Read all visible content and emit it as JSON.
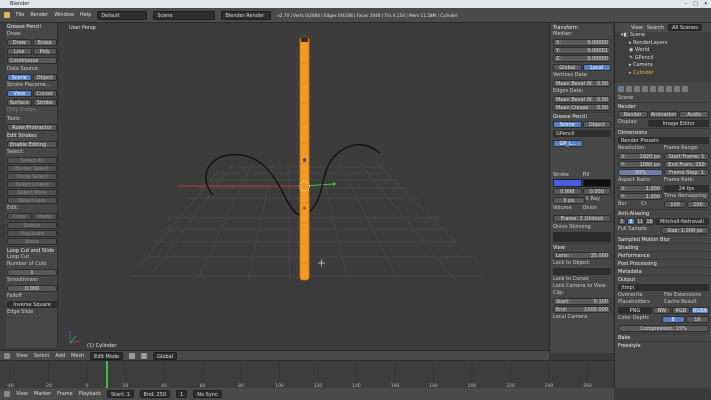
{
  "window": {
    "title": "Blender"
  },
  "info": {
    "menus": [
      "File",
      "Render",
      "Window",
      "Help"
    ],
    "layout": "Default",
    "scene": "Scene",
    "engine": "Blender Render",
    "stats": "v2.70 | Verts 0/2084 | Edges 0/4108 | Faces 2048 | Tris 4,154 | Mem 11.58M | Cylinder"
  },
  "toolshelf": {
    "header": "Grease Pencil",
    "draw_label": "Draw:",
    "draw_btns": [
      "Draw",
      "Erase"
    ],
    "line_btns": [
      "Line",
      "Poly"
    ],
    "continuous": "Continuous",
    "data_source": "Data Source:",
    "source_btns": [
      "Scene",
      "Object"
    ],
    "stroke_placement": "Stroke Placeme...",
    "placement_btns": [
      "View",
      "Cursor",
      "Surface",
      "Stroke"
    ],
    "only_endpoints": "Only Endpo...",
    "tools": "Tools:",
    "ruler": "Ruler/Protractor",
    "edit_strokes": "Edit Strokes",
    "enable_editing": "Enable Editing",
    "select": "Select:",
    "select_btns": [
      "Select All",
      "Border Select",
      "Circle Select",
      "Select Linked",
      "Select More",
      "Select Less"
    ],
    "edit": "Edit:",
    "edit_btns": [
      "Copy",
      "Paste",
      "Delete",
      "Duplicate",
      "Move"
    ],
    "operator_header": "Loop Cut and Slide",
    "loopcut": "Loop Cut",
    "num_cuts_label": "Number of Cuts",
    "num_cuts": "1",
    "smoothness_label": "Smoothness",
    "smoothness": "0.000",
    "falloff_label": "Falloff",
    "falloff": "Inverse Square",
    "edge_slide": "Edge Slide"
  },
  "viewport": {
    "label": "User Persp",
    "object": "(1) Cylinder"
  },
  "npanel": {
    "transform": "Transform",
    "median": "Median:",
    "x": "0.00000",
    "y": "0.00001",
    "z": "0.00000",
    "global": "Global",
    "local": "Local",
    "vertices_data": "Vertices Data:",
    "mean_bevel": "Mean Bevel W.",
    "mean_bevel_val": "0.00",
    "edges_data": "Edges Data:",
    "mean_bevel_e": "0.00",
    "mean_crease": "Mean Crease",
    "mean_crease_val": "0.00",
    "grease_pencil": "Grease Pencil",
    "gp_src": [
      "Scene",
      "Object"
    ],
    "gp_name": "GPencil",
    "layer": "GP_L...",
    "stroke": "Stroke",
    "fill": "Fill",
    "stroke_val": "0.998",
    "fill_val": "0.000",
    "thickness": "3 px",
    "xray": "X Ray",
    "volume": "Volume",
    "onion": "Onion",
    "frame": "Frame: 1 (Unlock",
    "onion_skin": "Onion Skinning",
    "view": "View",
    "lens_label": "Lens:",
    "lens": "35.000",
    "lock_to_object": "Lock to Object:",
    "lock_to_cursor": "Lock to Cursor",
    "lock_camera": "Lock Camera to View",
    "clip": "Clip:",
    "clip_start": "0.100",
    "clip_end": "1000.000",
    "start_label": "Start:",
    "end_label": "End:",
    "local_camera": "Local Camera"
  },
  "outliner": {
    "tabs": [
      "View",
      "Search",
      "All Scenes"
    ],
    "items": [
      "Scene",
      "RenderLayers",
      "World",
      "GPencil",
      "Camera",
      "Cylinder"
    ]
  },
  "props": {
    "breadcrumb": "Scene",
    "render": "Render",
    "render_btns": [
      "Render",
      "Animation",
      "Audio"
    ],
    "display_label": "Display:",
    "display": "Image Editor",
    "dimensions": "Dimensions",
    "render_presets": "Render Presets",
    "resolution": "Resolution:",
    "frame_range": "Frame Range:",
    "res_x": "1920 px",
    "res_y": "1080 px",
    "res_pct": "50%",
    "start_frame": "Start Frame: 1",
    "end_frame": "End Fram: 250",
    "frame_step": "Frame Step: 1",
    "aspect_ratio": "Aspect Ratio:",
    "frame_rate": "Frame Rate:",
    "asp_x": "1.000",
    "asp_y": "1.000",
    "fps": "24 fps",
    "time_remap": "Time Remapping:",
    "border": "Bor",
    "crop": "Cr",
    "old": "100",
    "new": "100",
    "anti_aliasing": "Anti-Aliasing",
    "aa_btns": [
      "5",
      "8",
      "11",
      "16"
    ],
    "filter": "Mitchell-Netravali",
    "full_sample": "Full Sample",
    "aa_size": "Size: 1.000 px",
    "sampled_motion_blur": "Sampled Motion Blur",
    "shading": "Shading",
    "performance": "Performance",
    "post_processing": "Post Processing",
    "metadata": "Metadata",
    "output": "Output",
    "output_path": "/tmp\\",
    "overwrite": "Overwrite",
    "file_ext": "File Extensions",
    "placeholders": "Placeholders",
    "cache_result": "Cache Result",
    "format": "PNG",
    "color_modes": [
      "BW",
      "RGB",
      "RGBA"
    ],
    "color_depth": "Color Depth:",
    "depth_vals": [
      "8",
      "16"
    ],
    "compression": "Compression:",
    "compression_val": "15%",
    "bake": "Bake",
    "freestyle": "Freestyle"
  },
  "v3dheader": {
    "menus": [
      "View",
      "Select",
      "Add",
      "Mesh"
    ],
    "mode": "Edit Mode",
    "pivot": "Global"
  },
  "timeline": {
    "ticks": [
      "-40",
      "-20",
      "0",
      "20",
      "40",
      "60",
      "80",
      "100",
      "120",
      "140",
      "160",
      "180",
      "200",
      "220",
      "240",
      "260"
    ],
    "footer_menus": [
      "View",
      "Marker",
      "Frame",
      "Playback"
    ],
    "start": "Start: 1",
    "end": "End: 250",
    "current": "1",
    "sync": "No Sync"
  },
  "colors": {
    "selection": "#f59a1e",
    "grid": "#4a4a4a",
    "accent": "#5680c2",
    "stroke_color": "#4a5ee0"
  }
}
